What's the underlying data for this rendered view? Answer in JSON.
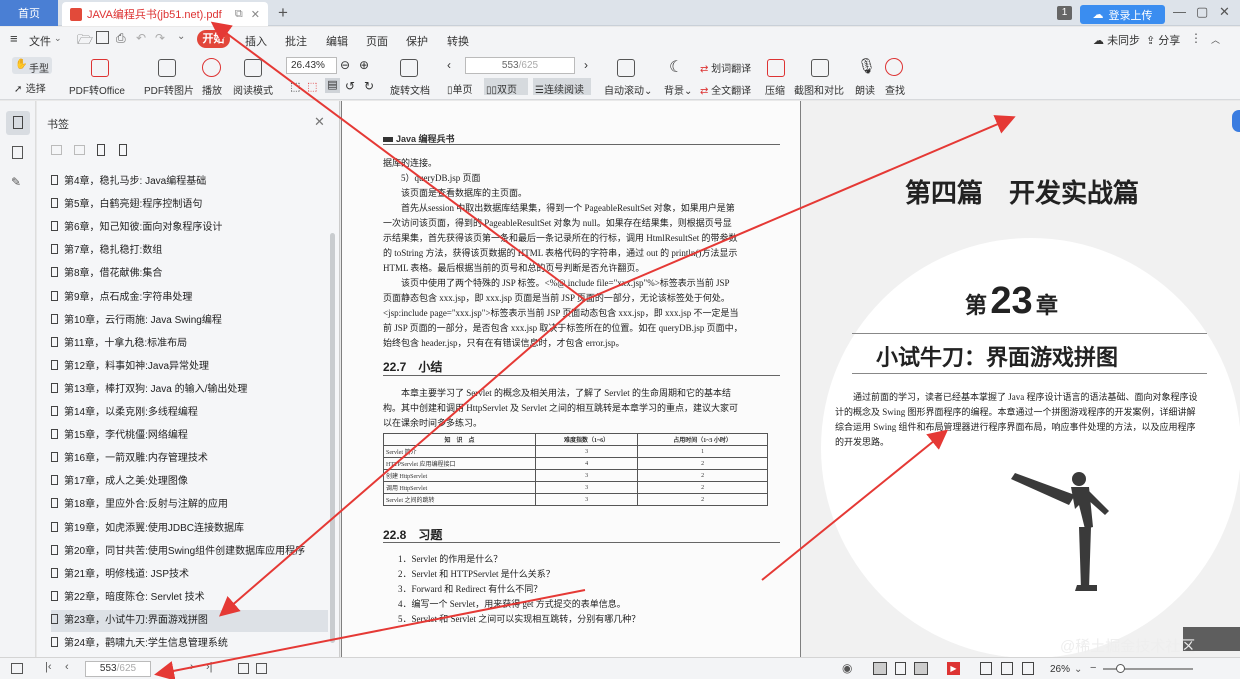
{
  "titlebar": {
    "home_tab": "首页",
    "doc_tab": "JAVA编程兵书(jb51.net).pdf",
    "badge": "1",
    "login": "登录上传",
    "win_min": "—",
    "win_max": "▢",
    "win_close": "✕"
  },
  "menubar": {
    "file": "文件",
    "items": [
      "开始",
      "插入",
      "批注",
      "编辑",
      "页面",
      "保护",
      "转换"
    ],
    "sync": "未同步",
    "share": "分享"
  },
  "toolbar": {
    "hand": "手型",
    "select": "选择",
    "pdf_to_office": "PDF转Office",
    "pdf_to_image": "PDF转图片",
    "play": "播放",
    "read_mode": "阅读模式",
    "zoom": "26.43%",
    "rotate": "旋转文档",
    "page_current": "553",
    "page_total": "/625",
    "single": "单页",
    "double": "双页",
    "continuous": "连续阅读",
    "autoscroll": "自动滚动",
    "background": "背景",
    "word_translate": "划词翻译",
    "full_translate": "全文翻译",
    "compress": "压缩",
    "screenshot": "截图和对比",
    "read_aloud": "朗读",
    "find": "查找"
  },
  "bookmarks": {
    "title": "书签",
    "items": [
      "第4章，稳扎马步: Java编程基础",
      "第5章，白鹤亮翅:程序控制语句",
      "第6章，知己知彼:面向对象程序设计",
      "第7章，稳扎稳打:数组",
      "第8章，借花献佛:集合",
      "第9章，点石成金:字符串处理",
      "第10章，云行雨施: Java Swing编程",
      "第11章，十拿九稳:标准布局",
      "第12章，料事如神:Java异常处理",
      "第13章，棒打双狗: Java 的输入/输出处理",
      "第14章，以柔克刚:多线程编程",
      "第15章，李代桃僵:网络编程",
      "第16章，一箭双雕:内存管理技术",
      "第17章，成人之美:处理图像",
      "第18章，里应外合:反射与注解的应用",
      "第19章，如虎添翼:使用JDBC连接数据库",
      "第20章，同甘共苦:使用Swing组件创建数据库应用程序",
      "第21章，明修栈道: JSP技术",
      "第22章，暗度陈仓: Servlet 技术",
      "第23章，小试牛刀:界面游戏拼图",
      "第24章，鹳啸九天:学生信息管理系统"
    ]
  },
  "left_page": {
    "header": "Java 编程兵书",
    "paragraphs": [
      "据库的连接。",
      "5）queryDB.jsp 页面",
      "该页面是查看数据库的主页面。",
      "首先从session 中取出数据库结果集，得到一个 PageableResultSet 对象，如果用户是第",
      "一次访问该页面，得到的 PageableResultSet 对象为 null。如果存在结果集，则根据页号显",
      "示结果集，首先获得该页第一条和最后一条记录所在的行标，调用 HtmlResultSet 的带参数",
      "的 toString 方法，获得该页数据的 HTML 表格代码的字符串，通过 out 的 println()方法显示",
      "HTML 表格。最后根据当前的页号和总的页号判断是否允许翻页。",
      "该页中使用了两个特殊的 JSP 标签。<%@ include file=\"xxx.jsp\"%>标签表示当前 JSP",
      "页面静态包含 xxx.jsp，即 xxx.jsp 页面是当前 JSP 页面的一部分，无论该标签处于何处。",
      "<jsp:include page=\"xxx.jsp\">标签表示当前 JSP 页面动态包含 xxx.jsp，即 xxx.jsp 不一定是当",
      "前 JSP 页面的一部分，是否包含 xxx.jsp 取决于标签所在的位置。如在 queryDB.jsp 页面中，",
      "始终包含 header.jsp，只有在有错误信息时，才包含 error.jsp。"
    ],
    "sec1_num": "22.7",
    "sec1_title": "小结",
    "sec1_body": [
      "本章主要学习了 Servlet 的概念及相关用法，了解了 Servlet 的生命周期和它的基本结",
      "构。其中创建和调用 HttpServlet 及 Servlet 之间的相互跳转是本章学习的重点，建议大家可",
      "以在课余时间多多练习。"
    ],
    "table_head": [
      "知　识　点",
      "难度指数（1~6）",
      "占用时间（1~3 小时）"
    ],
    "table_rows": [
      [
        "Servlet 简介",
        "3",
        "1"
      ],
      [
        "HTTPServlet 应用编程接口",
        "4",
        "2"
      ],
      [
        "创建 HttpServlet",
        "3",
        "2"
      ],
      [
        "调用 HttpServlet",
        "3",
        "2"
      ],
      [
        "Servlet 之间的跳转",
        "3",
        "2"
      ]
    ],
    "sec2_num": "22.8",
    "sec2_title": "习题",
    "exercises": [
      "1．Servlet 的作用是什么？",
      "2．Servlet 和 HTTPServlet 是什么关系？",
      "3．Forward 和 Redirect 有什么不同？",
      "4．编写一个 Servlet，用来获得 get 方式提交的表单信息。",
      "5．Servlet 和 Servlet 之间可以实现相互跳转，分别有哪几种？"
    ]
  },
  "right_page": {
    "part": "第四篇　开发实战篇",
    "chapter_pre": "第",
    "chapter_num": "23",
    "chapter_post": "章",
    "chapter_title": "小试牛刀：界面游戏拼图",
    "intro": [
      "通过前面的学习，读者已经基本掌握了 Java 程序设计语言的语法基础、面向对象程序设",
      "计的概念及 Swing 图形界面程序的编程。本章通过一个拼图游戏程序的开发案例，详细讲解",
      "综合运用 Swing 组件和布局管理器进行程序界面布局，响应事件处理的方法，以及应用程序",
      "的开发思路。"
    ]
  },
  "statusbar": {
    "page_current": "553",
    "page_total": "/625",
    "zoom": "26%",
    "watermark": "@稀土掘金技术社区"
  },
  "colors": {
    "accent": "#e2463a",
    "annotation_arrow": "#e53935",
    "login_blue": "#3a8df0"
  }
}
